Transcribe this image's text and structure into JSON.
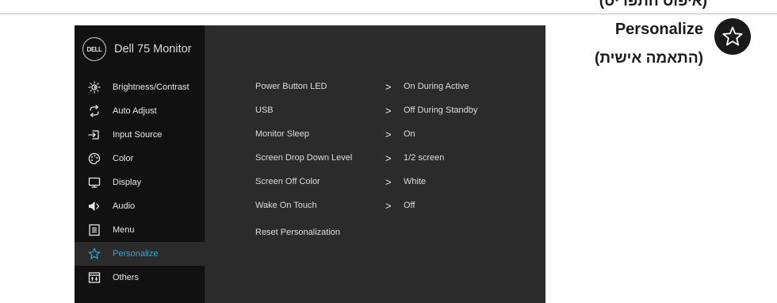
{
  "page": {
    "top_cut_label": "(איפוס התפריט)",
    "section_title": "Personalize",
    "section_subtitle": "(התאמה אישית)",
    "badge_icon": "star-outline-icon"
  },
  "osd": {
    "brand_logo_text": "DELL",
    "model_name": "Dell 75 Monitor",
    "accent_color": "#2aa7d6",
    "sidebar": [
      {
        "label": "Brightness/Contrast",
        "icon": "brightness-icon"
      },
      {
        "label": "Auto Adjust",
        "icon": "auto-adjust-icon"
      },
      {
        "label": "Input Source",
        "icon": "input-source-icon"
      },
      {
        "label": "Color",
        "icon": "color-palette-icon"
      },
      {
        "label": "Display",
        "icon": "display-icon"
      },
      {
        "label": "Audio",
        "icon": "speaker-icon"
      },
      {
        "label": "Menu",
        "icon": "menu-icon"
      },
      {
        "label": "Personalize",
        "icon": "star-icon",
        "active": true
      },
      {
        "label": "Others",
        "icon": "others-icon"
      }
    ],
    "settings": [
      {
        "label": "Power Button LED",
        "value": "On During Active"
      },
      {
        "label": "USB",
        "value": "Off During Standby"
      },
      {
        "label": "Monitor Sleep",
        "value": "On"
      },
      {
        "label": "Screen Drop Down Level",
        "value": "1/2 screen"
      },
      {
        "label": "Screen Off Color",
        "value": "White"
      },
      {
        "label": "Wake On Touch",
        "value": "Off"
      },
      {
        "label": "Reset Personalization",
        "value": ""
      }
    ],
    "chevron": ">"
  }
}
